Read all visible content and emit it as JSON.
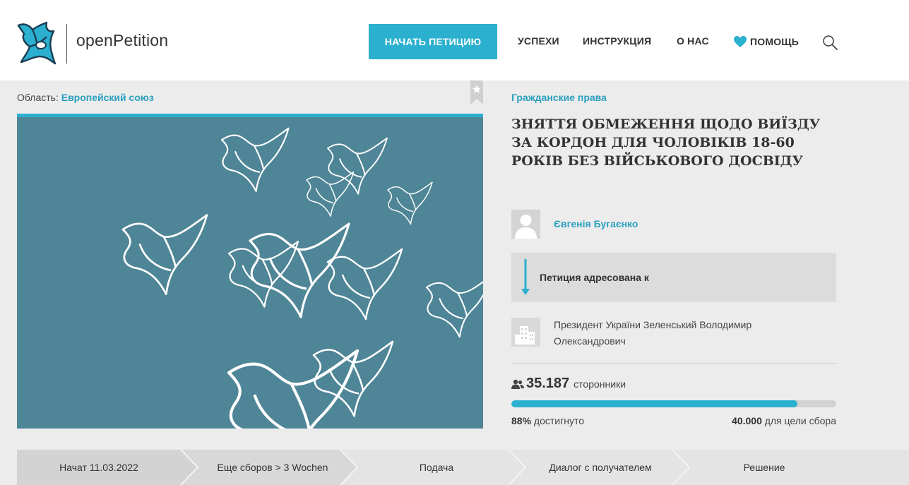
{
  "header": {
    "logo_text": "openPetition",
    "start_button": "НАЧАТЬ ПЕТИЦИЮ",
    "nav": {
      "successes": "УСПЕХИ",
      "instructions": "ИНСТРУКЦИЯ",
      "about": "О НАС",
      "help": "ПОМОЩЬ"
    },
    "accent_color": "#2bb0cf"
  },
  "petition": {
    "region_label": "Область:",
    "region_value": "Европейский союз",
    "category": "Гражданские права",
    "title": "ЗНЯТТЯ ОБМЕЖЕННЯ ЩОДО ВИЇЗДУ ЗА КОРДОН ДЛЯ ЧОЛОВІКІВ 18-60 РОКІВ БЕЗ ВІЙСЬКОВОГО ДОСВІДУ",
    "author": "Євгенія Бугаєнко",
    "addressed_label": "Петиция адресована к",
    "recipient": "Президент України Зеленський Володимир Олександрович",
    "supporters_count": "35.187",
    "supporters_label": "сторонники",
    "progress_percent": 88,
    "reached_value": "88%",
    "reached_label": "достигнуто",
    "goal_value": "40.000",
    "goal_label": "для цели сбора"
  },
  "steps": [
    {
      "label": "Начат 11.03.2022",
      "state": "done"
    },
    {
      "label": "Еще сборов > 3 Wochen",
      "state": "active"
    },
    {
      "label": "Подача",
      "state": "pending"
    },
    {
      "label": "Диалог с получателем",
      "state": "pending"
    },
    {
      "label": "Решение",
      "state": "pending"
    }
  ]
}
